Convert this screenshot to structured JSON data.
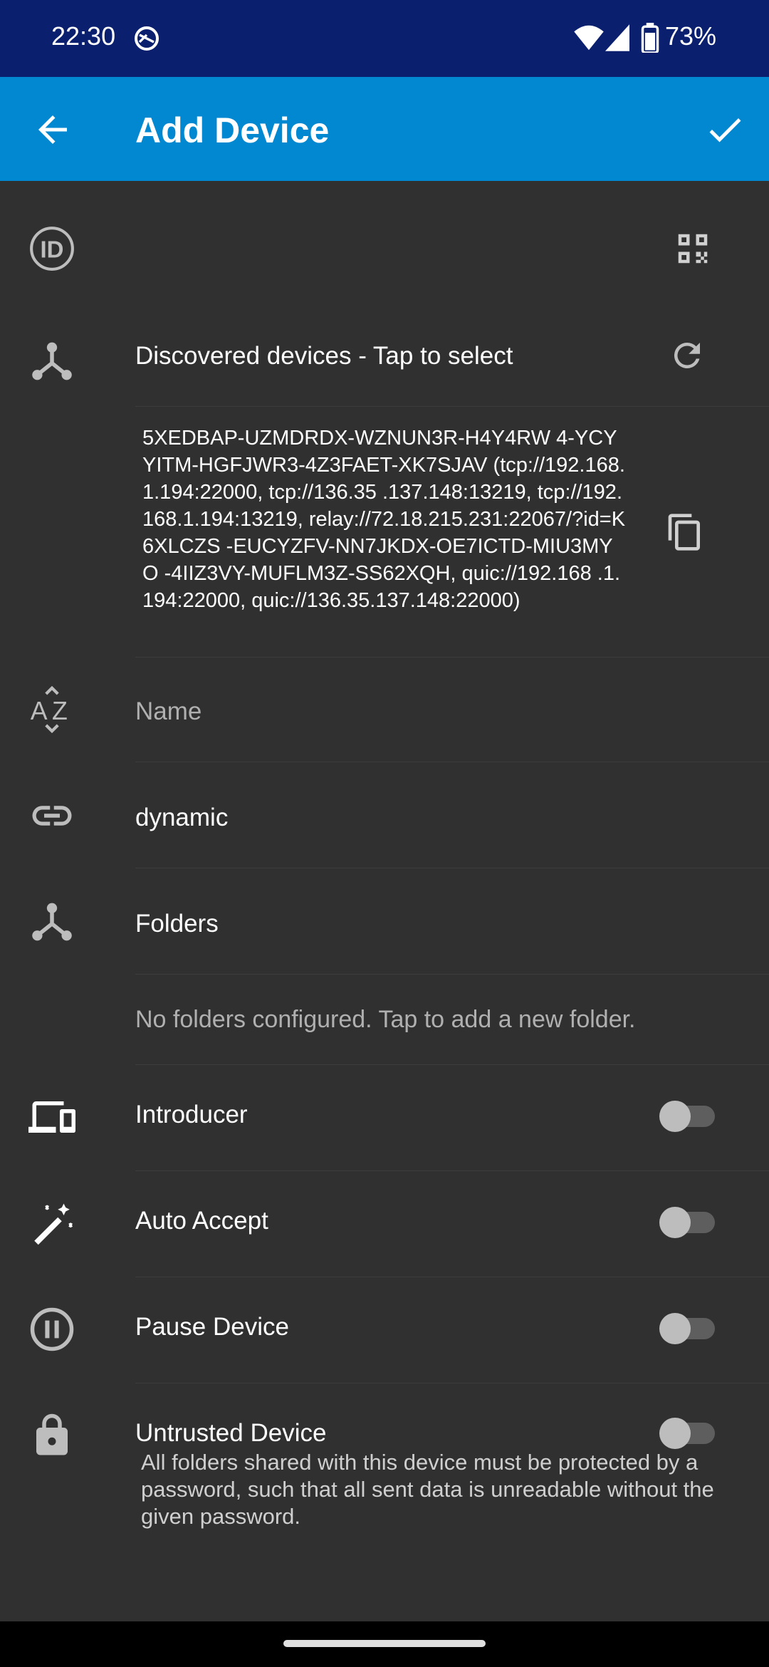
{
  "status_bar": {
    "time": "22:30",
    "battery": "73%",
    "icons": [
      "sync-icon",
      "wifi-icon",
      "signal-icon",
      "battery-icon"
    ]
  },
  "app_bar": {
    "title": "Add Device",
    "color": "#0288d1",
    "back_icon": "arrow-back-icon",
    "confirm_icon": "check-icon"
  },
  "fields": {
    "device_id_placeholder": "",
    "discovered_label": "Discovered devices - Tap to select",
    "device_id_value": "5XEDBAP-UZMDRDX-WZNUN3R-H4Y4RW 4-YCYYITM-HGFJWR3-4Z3FAET-XK7SJAV (tcp://192.168.1.194:22000, tcp://136.35 .137.148:13219, tcp://192.168.1.194:13219, relay://72.18.215.231:22067/?id=K6XLCZS -EUCYZFV-NN7JKDX-OE7ICTD-MIU3MYO -4IIZ3VY-MUFLM3Z-SS62XQH, quic://192.168 .1.194:22000, quic://136.35.137.148:22000)",
    "name_placeholder": "Name",
    "address_value": "dynamic",
    "folders_label": "Folders",
    "no_folders_text": "No folders configured. Tap to add a new folder."
  },
  "toggles": [
    {
      "label": "Introducer",
      "icon": "devices-icon",
      "on": false
    },
    {
      "label": "Auto Accept",
      "icon": "magic-wand-icon",
      "on": false
    },
    {
      "label": "Pause Device",
      "icon": "pause-circle-icon",
      "on": false
    },
    {
      "label": "Untrusted Device",
      "icon": "lock-icon",
      "on": false
    }
  ],
  "untrusted_description": "All folders shared with this device must be protected by a password, such that all sent data is unreadable without the given password."
}
